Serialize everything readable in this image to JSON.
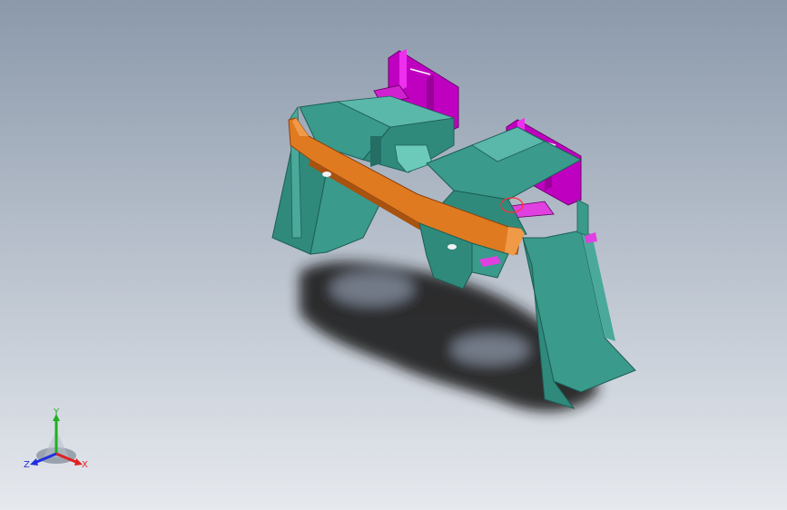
{
  "viewport": {
    "background_top": "#8c9aac",
    "background_bottom": "#e4e8ee",
    "selection_color": "#ff3030"
  },
  "model": {
    "icon": "cad-assembly",
    "colors": {
      "teal": "#3a9a8c",
      "teal_dark": "#2a7268",
      "teal_light": "#5ab8aa",
      "orange": "#e07a20",
      "orange_dark": "#a85210",
      "magenta": "#cc00cc",
      "magenta_dark": "#8a008a",
      "shadow": "#1a1a1a"
    }
  },
  "triad": {
    "icon": "coordinate-triad",
    "x_label": "X",
    "y_label": "Y",
    "z_label": "Z",
    "x_color": "#e02020",
    "y_color": "#20b020",
    "z_color": "#2030e0"
  }
}
